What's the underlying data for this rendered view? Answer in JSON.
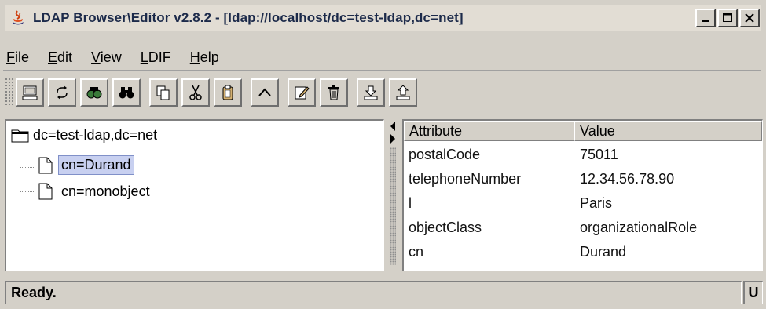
{
  "window": {
    "title": "LDAP Browser\\Editor v2.8.2 - [ldap://localhost/dc=test-ldap,dc=net]",
    "controls": [
      "minimize-icon",
      "maximize-icon",
      "close-icon"
    ]
  },
  "menu": {
    "items": [
      {
        "label": "File",
        "underline": "F"
      },
      {
        "label": "Edit",
        "underline": "E"
      },
      {
        "label": "View",
        "underline": "V"
      },
      {
        "label": "LDIF",
        "underline": "L"
      },
      {
        "label": "Help",
        "underline": "H"
      }
    ]
  },
  "toolbar": {
    "buttons": [
      "connect-icon",
      "refresh-icon",
      "search-icon",
      "find-icon",
      "copy-icon",
      "cut-icon",
      "paste-icon",
      "up-icon",
      "edit-icon",
      "delete-icon",
      "export-icon",
      "import-icon"
    ]
  },
  "tree": {
    "root": "dc=test-ldap,dc=net",
    "children": [
      {
        "label": "cn=Durand",
        "selected": true
      },
      {
        "label": "cn=monobject",
        "selected": false
      }
    ]
  },
  "table": {
    "columns": [
      "Attribute",
      "Value"
    ],
    "rows": [
      [
        "postalCode",
        "75011"
      ],
      [
        "telephoneNumber",
        "12.34.56.78.90"
      ],
      [
        "l",
        "Paris"
      ],
      [
        "objectClass",
        "organizationalRole"
      ],
      [
        "cn",
        "Durand"
      ]
    ]
  },
  "status": {
    "text": "Ready.",
    "side": "U"
  },
  "colors": {
    "chrome": "#d4d0c8",
    "title_text": "#1c2a4a",
    "selection": "#c8d0f0"
  }
}
